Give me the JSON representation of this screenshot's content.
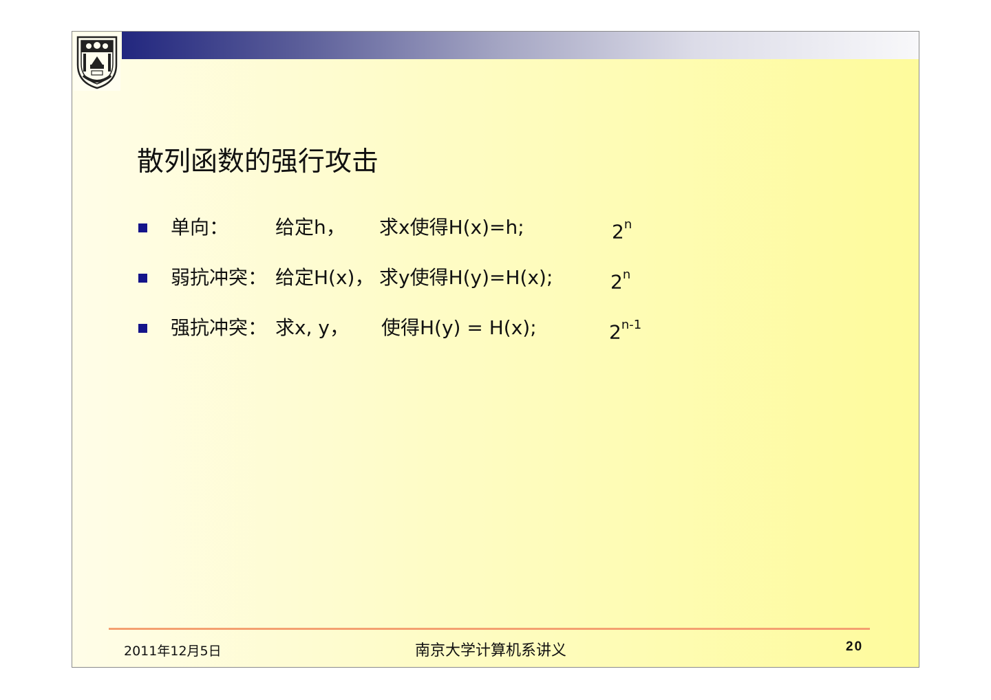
{
  "slide": {
    "title": "散列函数的强行攻击",
    "bullets": [
      {
        "label": "单向：",
        "given": "给定h，",
        "find": "求x使得H(x)=h;",
        "cost_base": "2",
        "cost_exp": "n"
      },
      {
        "label": "弱抗冲突：",
        "given": "给定H(x)，",
        "find": "求y使得H(y)=H(x);",
        "cost_base": "2",
        "cost_exp": "n"
      },
      {
        "label": "强抗冲突：",
        "given": "求x, y，",
        "find": "使得H(y) = H(x);",
        "cost_base": "2",
        "cost_exp": "n-1"
      }
    ]
  },
  "footer": {
    "date": "2011年12月5日",
    "center": "南京大学计算机系讲义",
    "page": "20"
  },
  "colors": {
    "header_dark": "#22277f",
    "bullet": "#14148a",
    "footer_line": "#f4a070",
    "background_right": "#fefb9c"
  },
  "logo": {
    "icon": "university-seal-icon"
  }
}
